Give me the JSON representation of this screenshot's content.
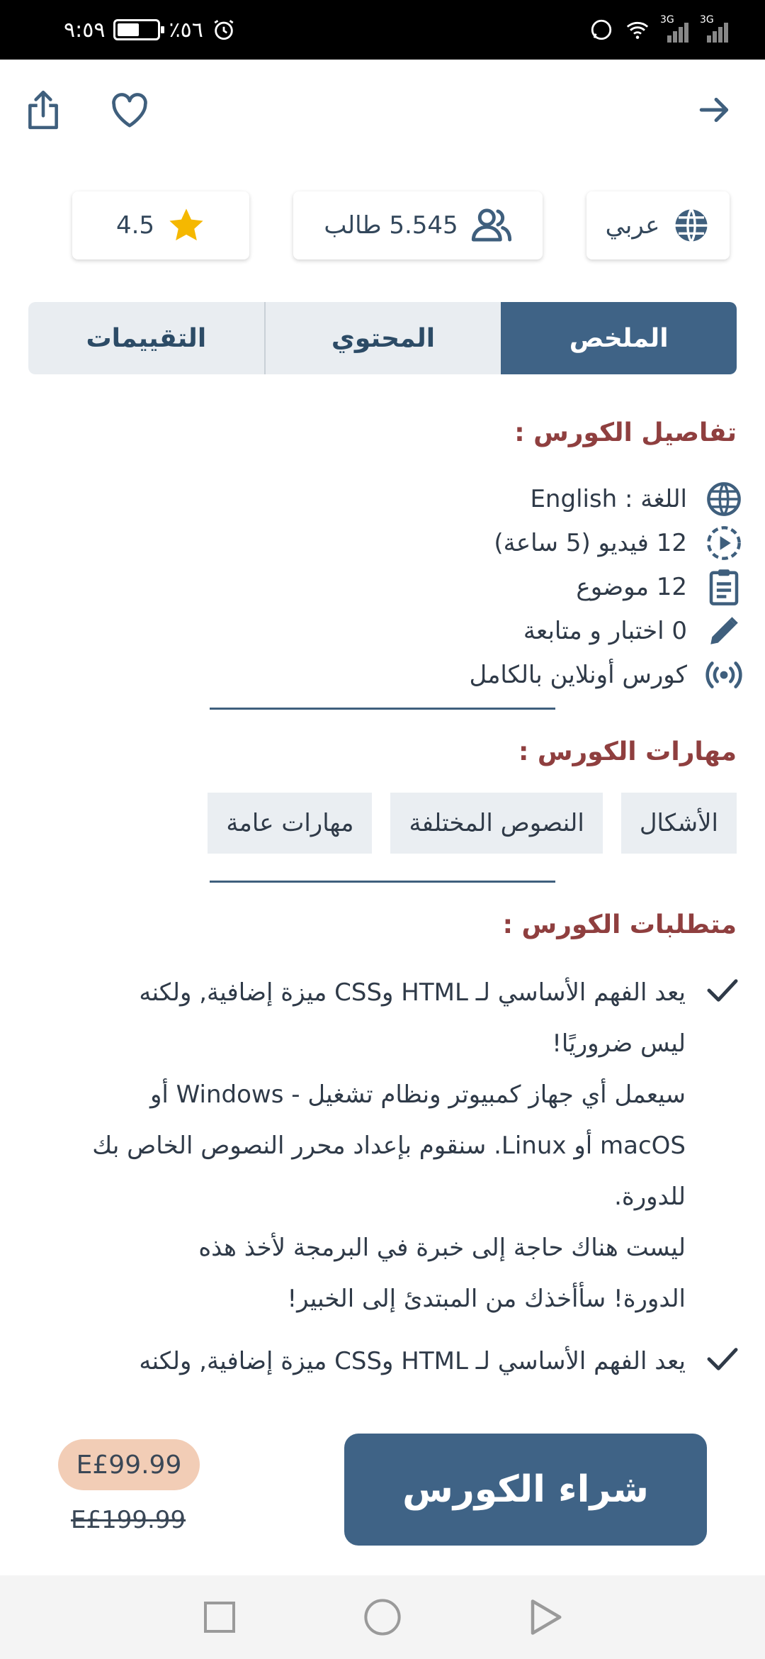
{
  "status_bar": {
    "time": "٩:٥٩",
    "battery_text": "٪٥٦",
    "battery_level": 0.56,
    "network_labels": [
      "3G",
      "3G"
    ]
  },
  "top_bar": {
    "back_icon": "arrow-right-icon",
    "favorite_icon": "heart-icon",
    "share_icon": "share-icon"
  },
  "stats": {
    "language": "عربي",
    "students": "5.545 طالب",
    "rating": "4.5"
  },
  "tabs": [
    {
      "label": "الملخص",
      "active": true
    },
    {
      "label": "المحتوي",
      "active": false
    },
    {
      "label": "التقييمات",
      "active": false
    }
  ],
  "details": {
    "title": "تفاصيل الكورس :",
    "items": [
      {
        "icon": "globe-icon",
        "text": "اللغة : English"
      },
      {
        "icon": "play-circle-icon",
        "text": "12 فيديو (5 ساعة)"
      },
      {
        "icon": "clipboard-icon",
        "text": "12 موضوع"
      },
      {
        "icon": "pencil-icon",
        "text": "0 اختبار و متابعة"
      },
      {
        "icon": "broadcast-icon",
        "text": "كورس أونلاين بالكامل"
      }
    ]
  },
  "skills": {
    "title": "مهارات الكورس :",
    "chips": [
      "الأشكال",
      "النصوص المختلفة",
      "مهارات عامة"
    ]
  },
  "requirements": {
    "title": "متطلبات الكورس :",
    "items": [
      {
        "lines": [
          "يعد الفهم الأساسي لـ HTML وCSS ميزة إضافية, ولكنه",
          "ليس ضروريًا!",
          "سيعمل أي جهاز كمبيوتر ونظام تشغيل - Windows أو",
          "macOS أو Linux. سنقوم بإعداد محرر النصوص الخاص بك",
          "للدورة.",
          "ليست هناك حاجة إلى خبرة في البرمجة لأخذ هذه",
          "الدورة! سأأخذك من المبتدئ إلى الخبير!"
        ]
      },
      {
        "lines": [
          "يعد الفهم الأساسي لـ HTML وCSS ميزة إضافية, ولكنه"
        ]
      }
    ]
  },
  "purchase": {
    "buy_label": "شراء الكورس",
    "price": "E£99.99",
    "old_price": "E£199.99"
  },
  "colors": {
    "primary": "#3f6386",
    "section_title": "#8f3f3f",
    "price_bg": "#f2cdb6",
    "star": "#f5b800"
  }
}
